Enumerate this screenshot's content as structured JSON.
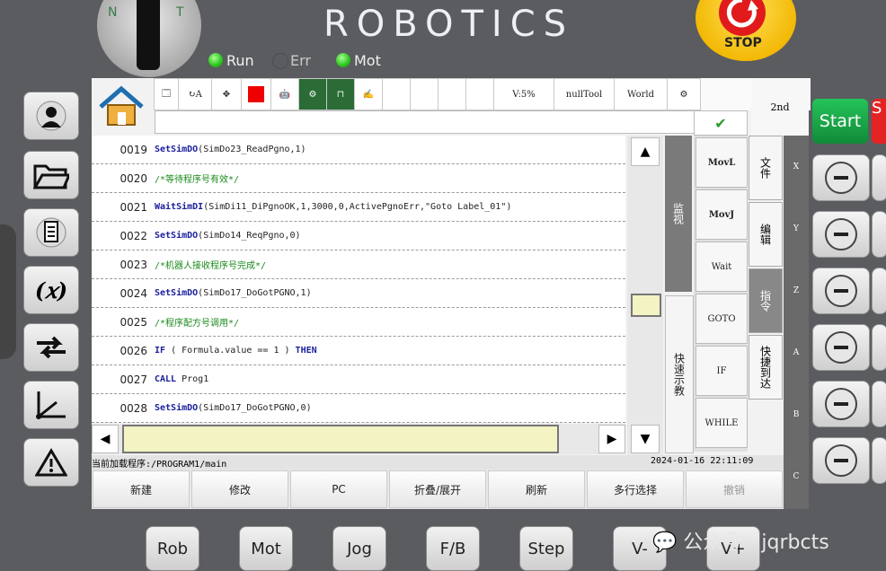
{
  "key": {
    "n": "N",
    "t": "T"
  },
  "brand": "ROBOTICS",
  "estop": "STOP",
  "status_leds": [
    {
      "label": "Run",
      "state": "on"
    },
    {
      "label": "Err",
      "state": "off"
    },
    {
      "label": "Mot",
      "state": "on"
    }
  ],
  "toolbar": {
    "velocity": "V:5%",
    "tool": "nullTool",
    "frame": "World",
    "second": "2nd",
    "a_label": "A"
  },
  "code_rows": [
    {
      "line": "0019",
      "parts": [
        [
          "kw",
          "SetSimDO"
        ],
        [
          "",
          "(SimDo23_ReadPgno,1)"
        ]
      ]
    },
    {
      "line": "0020",
      "parts": [
        [
          "cm",
          "/*等待程序号有效*/"
        ]
      ]
    },
    {
      "line": "0021",
      "parts": [
        [
          "kw",
          "WaitSimDI"
        ],
        [
          "",
          "(SimDi11_DiPgnoOK,1,3000,0,ActivePgnoErr,\"Goto Label_01\")"
        ]
      ]
    },
    {
      "line": "0022",
      "parts": [
        [
          "kw",
          "SetSimDO"
        ],
        [
          "",
          "(SimDo14_ReqPgno,0)"
        ]
      ]
    },
    {
      "line": "0023",
      "parts": [
        [
          "cm",
          "/*机器人接收程序号完成*/"
        ]
      ]
    },
    {
      "line": "0024",
      "parts": [
        [
          "kw",
          "SetSimDO"
        ],
        [
          "",
          "(SimDo17_DoGotPGNO,1)"
        ]
      ]
    },
    {
      "line": "0025",
      "parts": [
        [
          "cm",
          "/*程序配方号调用*/"
        ]
      ]
    },
    {
      "line": "0026",
      "parts": [
        [
          "kw",
          "IF"
        ],
        [
          "",
          " ( Formula.value == 1 ) "
        ],
        [
          "kw",
          "THEN"
        ]
      ]
    },
    {
      "line": "0027",
      "parts": [
        [
          "kw",
          "CALL"
        ],
        [
          "",
          " Prog1"
        ]
      ]
    },
    {
      "line": "0028",
      "parts": [
        [
          "kw",
          "SetSimDO"
        ],
        [
          "",
          "(SimDo17_DoGotPGNO,0)"
        ]
      ]
    }
  ],
  "vtabs": {
    "monitor": "监视",
    "quick": "快速示教"
  },
  "commands": [
    {
      "label": "MovL",
      "bold": true
    },
    {
      "label": "MovJ",
      "bold": true
    },
    {
      "label": "Wait",
      "bold": false
    },
    {
      "label": "GOTO",
      "bold": false
    },
    {
      "label": "IF",
      "bold": false
    },
    {
      "label": "WHILE",
      "bold": false
    }
  ],
  "side_tabs": [
    {
      "label": "文件",
      "selected": false
    },
    {
      "label": "编辑",
      "selected": false
    },
    {
      "label": "指令",
      "selected": true
    },
    {
      "label": "快捷到达",
      "selected": false
    }
  ],
  "axes": [
    "X",
    "Y",
    "Z",
    "A",
    "B",
    "C"
  ],
  "status_bar": {
    "program": "当前加载程序:/PROGRAM1/main",
    "datetime": "2024-01-16 22:11:09"
  },
  "bottom_buttons": [
    {
      "label": "新建",
      "disabled": false
    },
    {
      "label": "修改",
      "disabled": false
    },
    {
      "label": "PC",
      "disabled": false
    },
    {
      "label": "折叠/展开",
      "disabled": false
    },
    {
      "label": "刷新",
      "disabled": false
    },
    {
      "label": "多行选择",
      "disabled": false
    },
    {
      "label": "撤销",
      "disabled": true
    }
  ],
  "physical_buttons": [
    "Rob",
    "Mot",
    "Jog",
    "F/B",
    "Step",
    "V-",
    "V+"
  ],
  "start": "Start",
  "start_partial": "S",
  "watermark": "公众号 · jqrbcts",
  "colors": {
    "accent_green": "#1fb34f",
    "estop_yellow": "#f2b600",
    "keyword_blue": "#1a1f9c",
    "comment_green": "#1c8a1c"
  }
}
